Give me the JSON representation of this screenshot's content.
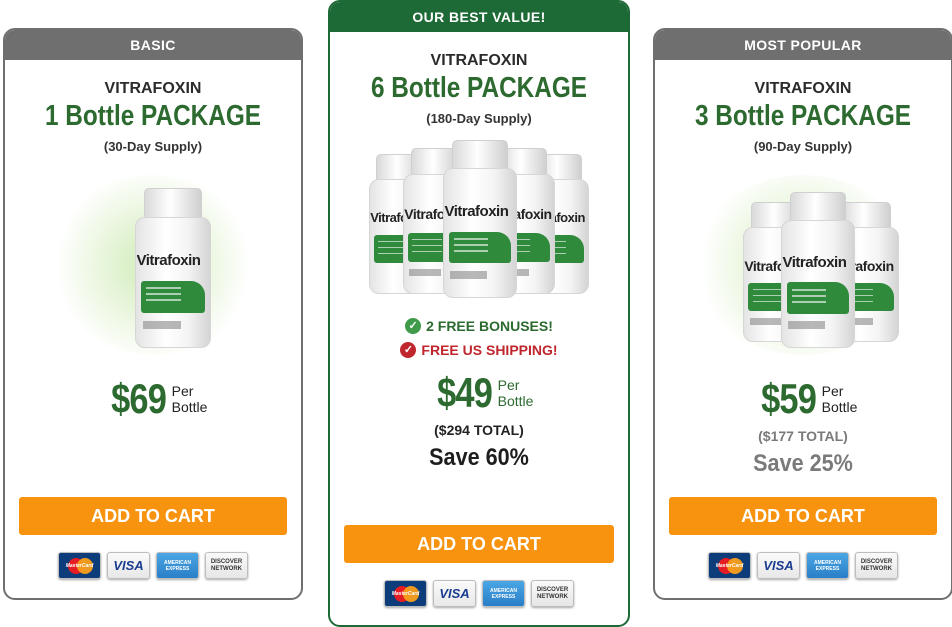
{
  "packages": {
    "basic": {
      "header": "BASIC",
      "brand": "VITRAFOXIN",
      "title": "1 Bottle PACKAGE",
      "supply": "(30-Day Supply)",
      "bottle_label": "Vitrafoxin",
      "price": "$69",
      "per": "Per",
      "per_unit": "Bottle",
      "cart": "ADD TO CART"
    },
    "best": {
      "header": "OUR BEST VALUE!",
      "brand": "VITRAFOXIN",
      "title": "6 Bottle PACKAGE",
      "supply": "(180-Day Supply)",
      "bottle_label": "Vitrafoxin",
      "bonus": "2 FREE BONUSES!",
      "shipping": "FREE US SHIPPING!",
      "price": "$49",
      "per": "Per",
      "per_unit": "Bottle",
      "total": "($294 TOTAL)",
      "save": "Save 60%",
      "cart": "ADD TO CART"
    },
    "popular": {
      "header": "MOST POPULAR",
      "brand": "VITRAFOXIN",
      "title": "3 Bottle PACKAGE",
      "supply": "(90-Day Supply)",
      "bottle_label": "Vitrafoxin",
      "price": "$59",
      "per": "Per",
      "per_unit": "Bottle",
      "total": "($177 TOTAL)",
      "save": "Save 25%",
      "cart": "ADD TO CART"
    }
  },
  "payment_cards": {
    "mastercard": "MasterCard",
    "visa": "VISA",
    "amex_line1": "AMERICAN",
    "amex_line2": "EXPRESS",
    "discover_line1": "DISCOVER",
    "discover_line2": "NETWORK"
  },
  "colors": {
    "green": "#2c6a30",
    "dark_green_header": "#1e6a37",
    "gray_header": "#6f6f6f",
    "cart_orange": "#f7930e",
    "shipping_red": "#c0262d"
  },
  "icons": {
    "bonus": "check-circle-icon",
    "shipping": "check-circle-icon"
  }
}
